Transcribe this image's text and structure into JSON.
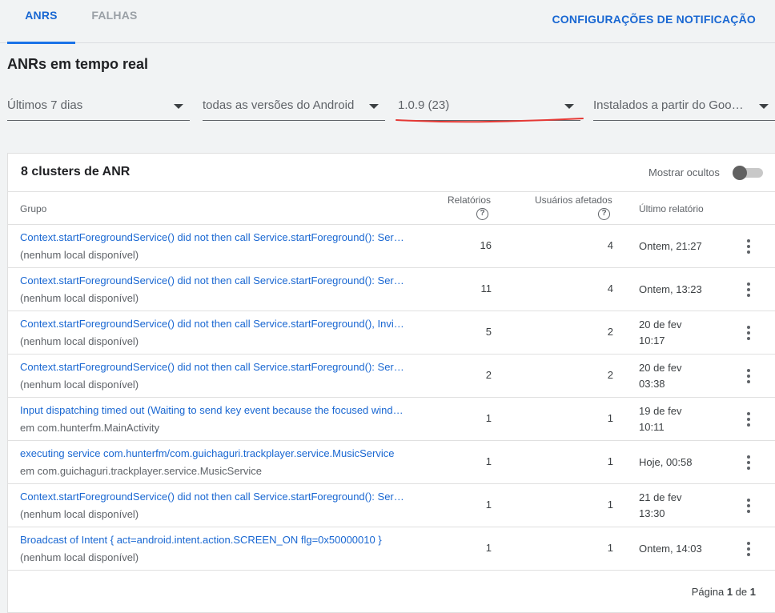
{
  "tabs": [
    {
      "label": "ANRS"
    },
    {
      "label": "FALHAS"
    }
  ],
  "notification_settings_label": "CONFIGURAÇÕES DE NOTIFICAÇÃO",
  "page_title": "ANRs em tempo real",
  "filters": {
    "period": "Últimos 7 dias",
    "android_version": "todas as versões do Android",
    "app_version": "1.0.9 (23)",
    "install_source": "Instalados a partir do Google …"
  },
  "annotation_color": "#e53935",
  "card": {
    "title": "8 clusters de ANR",
    "show_hidden_label": "Mostrar ocultos",
    "show_hidden_on": false
  },
  "table": {
    "headers": {
      "group": "Grupo",
      "reports": "Relatórios",
      "users": "Usuários afetados",
      "last_report": "Último relatório",
      "help_glyph": "?"
    },
    "rows": [
      {
        "title": "Context.startForegroundService() did not then call Service.startForeground(): Serv…",
        "subtitle": "(nenhum local disponível)",
        "reports": "16",
        "users": "4",
        "last_line1": "Ontem, 21:27",
        "last_line2": ""
      },
      {
        "title": "Context.startForegroundService() did not then call Service.startForeground(): Serv…",
        "subtitle": "(nenhum local disponível)",
        "reports": "11",
        "users": "4",
        "last_line1": "Ontem, 13:23",
        "last_line2": ""
      },
      {
        "title": "Context.startForegroundService() did not then call Service.startForeground(), Invi…",
        "subtitle": "(nenhum local disponível)",
        "reports": "5",
        "users": "2",
        "last_line1": "20 de fev",
        "last_line2": "10:17"
      },
      {
        "title": "Context.startForegroundService() did not then call Service.startForeground(): Serv…",
        "subtitle": "(nenhum local disponível)",
        "reports": "2",
        "users": "2",
        "last_line1": "20 de fev",
        "last_line2": "03:38"
      },
      {
        "title": "Input dispatching timed out (Waiting to send key event because the focused wind…",
        "subtitle": "em com.hunterfm.MainActivity",
        "reports": "1",
        "users": "1",
        "last_line1": "19 de fev",
        "last_line2": "10:11"
      },
      {
        "title": "executing service com.hunterfm/com.guichaguri.trackplayer.service.MusicService",
        "subtitle": "em com.guichaguri.trackplayer.service.MusicService",
        "reports": "1",
        "users": "1",
        "last_line1": "Hoje, 00:58",
        "last_line2": ""
      },
      {
        "title": "Context.startForegroundService() did not then call Service.startForeground(): Serv…",
        "subtitle": "(nenhum local disponível)",
        "reports": "1",
        "users": "1",
        "last_line1": "21 de fev",
        "last_line2": "13:30"
      },
      {
        "title": "Broadcast of Intent { act=android.intent.action.SCREEN_ON flg=0x50000010 }",
        "subtitle": "(nenhum local disponível)",
        "reports": "1",
        "users": "1",
        "last_line1": "Ontem, 14:03",
        "last_line2": ""
      }
    ]
  },
  "pagination": {
    "prefix": "Página",
    "current": "1",
    "separator": "de",
    "total": "1"
  }
}
